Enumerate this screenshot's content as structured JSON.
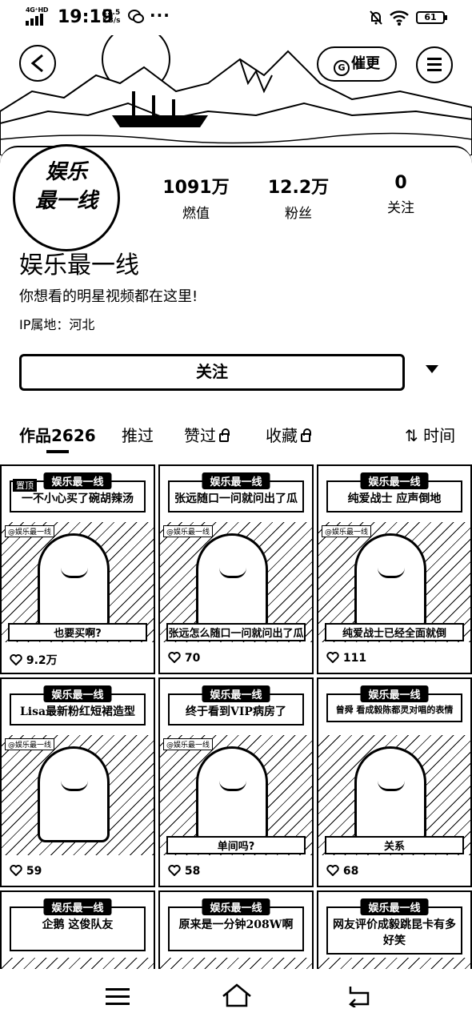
{
  "status_bar": {
    "network": "4G⁺HD",
    "time": "19:19",
    "speed_value": "12.5",
    "speed_unit": "KB/s",
    "more": "···",
    "battery": "61"
  },
  "header": {
    "update_label": "催更",
    "update_icon_letter": "G"
  },
  "profile": {
    "avatar_line1": "娱乐",
    "avatar_line2": "最一线",
    "name": "娱乐最一线",
    "bio": "你想看的明星视频都在这里!",
    "ip": "IP属地：河北",
    "stats": [
      {
        "num": "1091万",
        "label": "燃值"
      },
      {
        "num": "12.2万",
        "label": "粉丝"
      },
      {
        "num": "0",
        "label": "关注"
      }
    ],
    "follow_label": "关注"
  },
  "tabs": {
    "works": "作品2626",
    "recommended": "推过",
    "liked": "赞过",
    "favorites": "收藏",
    "sort": "时间"
  },
  "videos": [
    {
      "banner": "娱乐最一线",
      "title": "一不小心买了碗胡辣汤",
      "sub": "也要买啊?",
      "likes": "9.2万",
      "badge": "置顶"
    },
    {
      "banner": "娱乐最一线",
      "title": "张远随口一问就问出了瓜",
      "sub": "张远怎么随口一问就问出了瓜",
      "likes": "70"
    },
    {
      "banner": "娱乐最一线",
      "title": "纯爱战士 应声倒地",
      "sub": "纯爱战士已经全面就倒",
      "likes": "111"
    },
    {
      "banner": "娱乐最一线",
      "title": "Lisa最新粉红短裙造型",
      "sub": "",
      "likes": "59"
    },
    {
      "banner": "娱乐最一线",
      "title": "终于看到VIP病房了",
      "sub": "单间吗?",
      "likes": "58"
    },
    {
      "banner": "娱乐最一线",
      "title": "曾舜 看成毅陈都灵对唱的表情",
      "sub": "关系",
      "likes": "68"
    },
    {
      "banner": "娱乐最一线",
      "title": "企鹅 这俊队友"
    },
    {
      "banner": "娱乐最一线",
      "title": "原来是一分钟208W啊"
    },
    {
      "banner": "娱乐最一线",
      "title": "网友评价成毅跳昆卡有多好笑"
    }
  ],
  "watermark": "@娱乐最一线"
}
